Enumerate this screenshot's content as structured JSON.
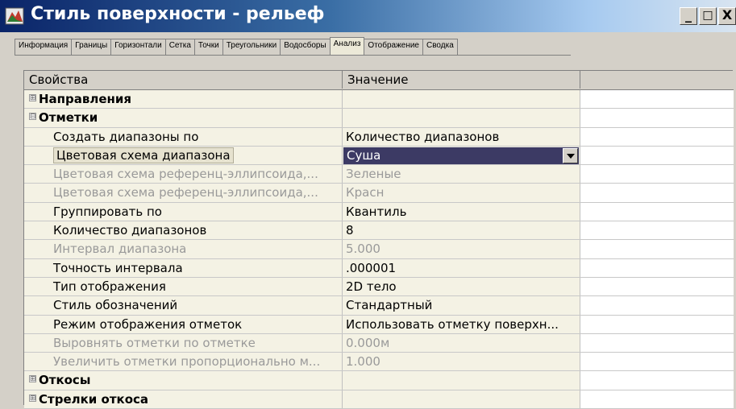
{
  "window": {
    "title": "Стиль поверхности - рельеф",
    "minimize": "_",
    "maximize": "□",
    "close": "X"
  },
  "tabs": [
    {
      "label": "Информация"
    },
    {
      "label": "Границы"
    },
    {
      "label": "Горизонтали"
    },
    {
      "label": "Сетка"
    },
    {
      "label": "Точки"
    },
    {
      "label": "Треугольники"
    },
    {
      "label": "Водосборы"
    },
    {
      "label": "Анализ",
      "active": true
    },
    {
      "label": "Отображение"
    },
    {
      "label": "Сводка"
    }
  ],
  "grid": {
    "col_property": "Свойства",
    "col_value": "Значение",
    "rows": [
      {
        "type": "cat",
        "expander": "⊞",
        "label": "Направления",
        "value": ""
      },
      {
        "type": "cat",
        "expander": "⊟",
        "label": "Отметки",
        "value": ""
      },
      {
        "type": "prop",
        "label": "Создать диапазоны по",
        "value": "Количество диапазонов"
      },
      {
        "type": "dropdown",
        "label": "Цветовая схема диапазона",
        "value": "Суша"
      },
      {
        "type": "disabled",
        "label": "Цветовая схема референц-эллипсоида,...",
        "value": "Зеленые"
      },
      {
        "type": "disabled",
        "label": "Цветовая схема референц-эллипсоида,...",
        "value": "Красн"
      },
      {
        "type": "prop",
        "label": "Группировать по",
        "value": "Квантиль"
      },
      {
        "type": "prop",
        "label": "Количество диапазонов",
        "value": "8"
      },
      {
        "type": "disabled",
        "label": "Интервал диапазона",
        "value": "5.000"
      },
      {
        "type": "prop",
        "label": "Точность интервала",
        "value": ".000001"
      },
      {
        "type": "prop",
        "label": "Тип отображения",
        "value": "2D тело"
      },
      {
        "type": "prop",
        "label": "Стиль обозначений",
        "value": "Стандартный"
      },
      {
        "type": "prop",
        "label": "Режим отображения отметок",
        "value": "Использовать отметку поверхн..."
      },
      {
        "type": "disabled",
        "label": "Выровнять отметки по отметке",
        "value": "0.000м"
      },
      {
        "type": "disabled",
        "label": "Увеличить отметки пропорционально м...",
        "value": "1.000"
      },
      {
        "type": "cat",
        "expander": "⊞",
        "label": "Откосы",
        "value": ""
      },
      {
        "type": "cat",
        "expander": "⊞",
        "label": "Стрелки откоса",
        "value": ""
      }
    ]
  }
}
